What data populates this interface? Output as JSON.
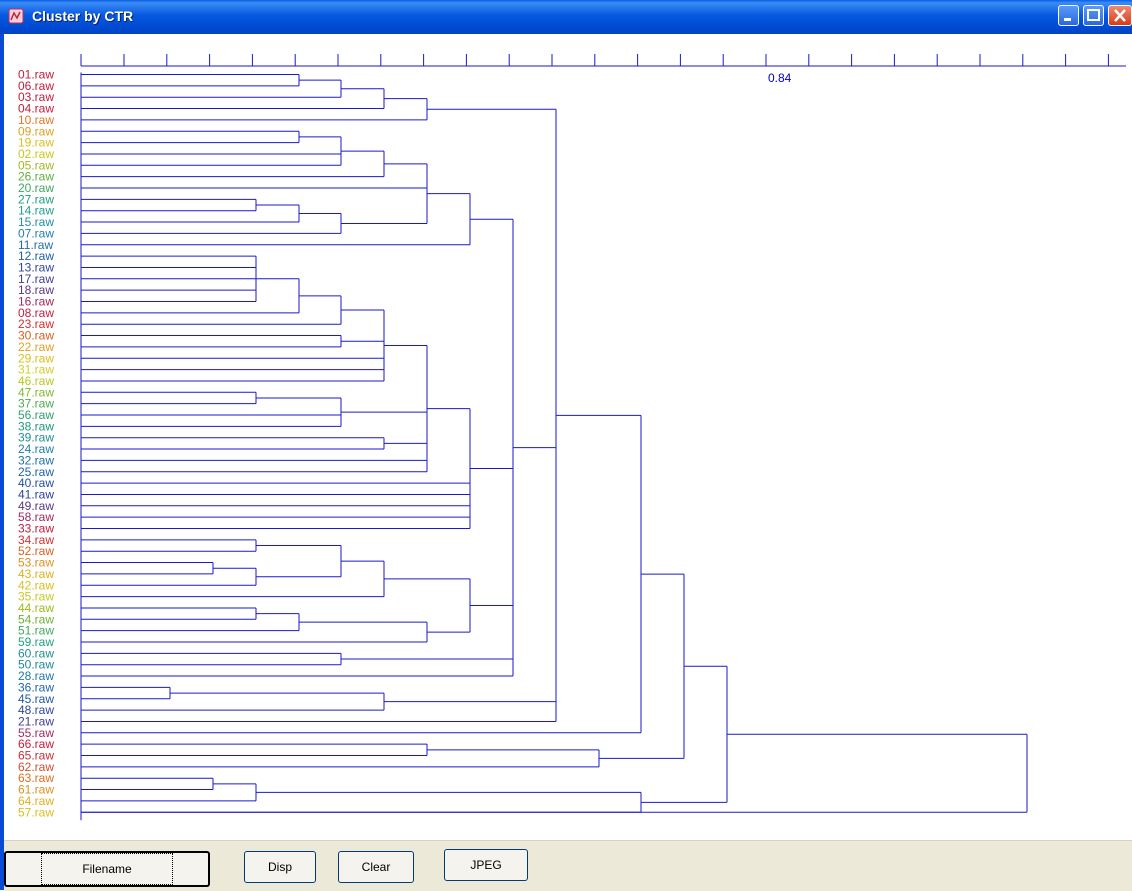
{
  "window": {
    "title": "Cluster by CTR",
    "icons": [
      "app-icon",
      "minimize-icon",
      "maximize-icon",
      "close-icon"
    ]
  },
  "axis": {
    "label": "0.84"
  },
  "leaves": [
    {
      "name": "01.raw",
      "color": "#c02040"
    },
    {
      "name": "06.raw",
      "color": "#c02040"
    },
    {
      "name": "03.raw",
      "color": "#c02040"
    },
    {
      "name": "04.raw",
      "color": "#c02040"
    },
    {
      "name": "10.raw",
      "color": "#e07820"
    },
    {
      "name": "09.raw",
      "color": "#e0a020"
    },
    {
      "name": "19.raw",
      "color": "#d8c020"
    },
    {
      "name": "02.raw",
      "color": "#c8c820"
    },
    {
      "name": "05.raw",
      "color": "#a0b820"
    },
    {
      "name": "26.raw",
      "color": "#60b040"
    },
    {
      "name": "20.raw",
      "color": "#40a860"
    },
    {
      "name": "27.raw",
      "color": "#20a080"
    },
    {
      "name": "14.raw",
      "color": "#20a090"
    },
    {
      "name": "15.raw",
      "color": "#2090a0"
    },
    {
      "name": "07.raw",
      "color": "#2080a8"
    },
    {
      "name": "11.raw",
      "color": "#2070a8"
    },
    {
      "name": "12.raw",
      "color": "#2060a0"
    },
    {
      "name": "13.raw",
      "color": "#304898"
    },
    {
      "name": "17.raw",
      "color": "#404090"
    },
    {
      "name": "18.raw",
      "color": "#583880"
    },
    {
      "name": "16.raw",
      "color": "#a02860"
    },
    {
      "name": "08.raw",
      "color": "#c02040"
    },
    {
      "name": "23.raw",
      "color": "#d03030"
    },
    {
      "name": "30.raw",
      "color": "#d86020"
    },
    {
      "name": "22.raw",
      "color": "#e0a020"
    },
    {
      "name": "29.raw",
      "color": "#d8c020"
    },
    {
      "name": "31.raw",
      "color": "#d0d020"
    },
    {
      "name": "46.raw",
      "color": "#b8c820"
    },
    {
      "name": "47.raw",
      "color": "#80b830"
    },
    {
      "name": "37.raw",
      "color": "#50a850"
    },
    {
      "name": "56.raw",
      "color": "#30a070"
    },
    {
      "name": "38.raw",
      "color": "#209880"
    },
    {
      "name": "39.raw",
      "color": "#209090"
    },
    {
      "name": "24.raw",
      "color": "#2080a0"
    },
    {
      "name": "32.raw",
      "color": "#2070a8"
    },
    {
      "name": "25.raw",
      "color": "#2060a8"
    },
    {
      "name": "40.raw",
      "color": "#2050a0"
    },
    {
      "name": "41.raw",
      "color": "#304098"
    },
    {
      "name": "49.raw",
      "color": "#583880"
    },
    {
      "name": "58.raw",
      "color": "#a02860"
    },
    {
      "name": "33.raw",
      "color": "#c02040"
    },
    {
      "name": "34.raw",
      "color": "#d03030"
    },
    {
      "name": "52.raw",
      "color": "#d86020"
    },
    {
      "name": "53.raw",
      "color": "#e09020"
    },
    {
      "name": "43.raw",
      "color": "#e0b020"
    },
    {
      "name": "42.raw",
      "color": "#d8c020"
    },
    {
      "name": "35.raw",
      "color": "#c8c820"
    },
    {
      "name": "44.raw",
      "color": "#a0b820"
    },
    {
      "name": "54.raw",
      "color": "#70b038"
    },
    {
      "name": "51.raw",
      "color": "#40a860"
    },
    {
      "name": "59.raw",
      "color": "#20a080"
    },
    {
      "name": "60.raw",
      "color": "#209090"
    },
    {
      "name": "50.raw",
      "color": "#2088a0"
    },
    {
      "name": "28.raw",
      "color": "#2078a8"
    },
    {
      "name": "36.raw",
      "color": "#2068a8"
    },
    {
      "name": "45.raw",
      "color": "#2058a0"
    },
    {
      "name": "48.raw",
      "color": "#304898"
    },
    {
      "name": "21.raw",
      "color": "#404090"
    },
    {
      "name": "55.raw",
      "color": "#a02860"
    },
    {
      "name": "66.raw",
      "color": "#c02040"
    },
    {
      "name": "65.raw",
      "color": "#c83038"
    },
    {
      "name": "62.raw",
      "color": "#d05030"
    },
    {
      "name": "63.raw",
      "color": "#d87020"
    },
    {
      "name": "61.raw",
      "color": "#e09020"
    },
    {
      "name": "64.raw",
      "color": "#e0b020"
    },
    {
      "name": "57.raw",
      "color": "#d8c020"
    }
  ],
  "buttons": {
    "filename": "Filename",
    "disp": "Disp",
    "clear": "Clear",
    "jpeg": "JPEG"
  }
}
